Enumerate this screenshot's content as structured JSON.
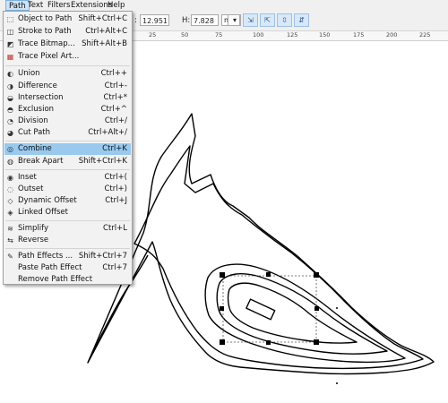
{
  "menubar": {
    "items": [
      "Path",
      "Text",
      "Filters",
      "Extensions",
      "Help"
    ],
    "active": "Path"
  },
  "toolbar": {
    "w_value": "12.951",
    "h_label": "H:",
    "h_value": "7.828",
    "unit": "mm",
    "unit_arrow": "▾",
    "buttons": [
      "⇲",
      "⇱",
      "⇳",
      "⇵"
    ]
  },
  "ruler": {
    "labels": [
      "25",
      "50",
      "75",
      "100",
      "125",
      "150",
      "175",
      "200",
      "225",
      "250"
    ]
  },
  "path_menu": {
    "items": [
      {
        "icon": "object-to-path-icon",
        "glyph": "⬚",
        "label": "Object to Path",
        "shortcut": "Shift+Ctrl+C"
      },
      {
        "icon": "stroke-to-path-icon",
        "glyph": "◫",
        "label": "Stroke to Path",
        "shortcut": "Ctrl+Alt+C"
      },
      {
        "icon": "trace-bitmap-icon",
        "glyph": "◩",
        "label": "Trace Bitmap...",
        "shortcut": "Shift+Alt+B"
      },
      {
        "icon": "trace-pixel-art-icon",
        "glyph": "▦",
        "label": "Trace Pixel Art...",
        "shortcut": ""
      },
      {
        "icon": "union-icon",
        "glyph": "◐",
        "label": "Union",
        "shortcut": "Ctrl++"
      },
      {
        "icon": "difference-icon",
        "glyph": "◑",
        "label": "Difference",
        "shortcut": "Ctrl+-"
      },
      {
        "icon": "intersection-icon",
        "glyph": "◒",
        "label": "Intersection",
        "shortcut": "Ctrl+*"
      },
      {
        "icon": "exclusion-icon",
        "glyph": "◓",
        "label": "Exclusion",
        "shortcut": "Ctrl+^"
      },
      {
        "icon": "division-icon",
        "glyph": "◔",
        "label": "Division",
        "shortcut": "Ctrl+/"
      },
      {
        "icon": "cut-path-icon",
        "glyph": "◕",
        "label": "Cut Path",
        "shortcut": "Ctrl+Alt+/"
      },
      {
        "icon": "combine-icon",
        "glyph": "◎",
        "label": "Combine",
        "shortcut": "Ctrl+K"
      },
      {
        "icon": "break-apart-icon",
        "glyph": "◍",
        "label": "Break Apart",
        "shortcut": "Shift+Ctrl+K"
      },
      {
        "icon": "inset-icon",
        "glyph": "◉",
        "label": "Inset",
        "shortcut": "Ctrl+("
      },
      {
        "icon": "outset-icon",
        "glyph": "◌",
        "label": "Outset",
        "shortcut": "Ctrl+)"
      },
      {
        "icon": "dynamic-offset-icon",
        "glyph": "◇",
        "label": "Dynamic Offset",
        "shortcut": "Ctrl+J"
      },
      {
        "icon": "linked-offset-icon",
        "glyph": "◈",
        "label": "Linked Offset",
        "shortcut": ""
      },
      {
        "icon": "simplify-icon",
        "glyph": "≋",
        "label": "Simplify",
        "shortcut": "Ctrl+L"
      },
      {
        "icon": "reverse-icon",
        "glyph": "⇆",
        "label": "Reverse",
        "shortcut": ""
      },
      {
        "icon": "path-effects-icon",
        "glyph": "✎",
        "label": "Path Effects ...",
        "shortcut": "Shift+Ctrl+7"
      },
      {
        "icon": "",
        "glyph": "",
        "label": "Paste Path Effect",
        "shortcut": "Ctrl+7"
      },
      {
        "icon": "",
        "glyph": "",
        "label": "Remove Path Effect",
        "shortcut": ""
      }
    ]
  }
}
